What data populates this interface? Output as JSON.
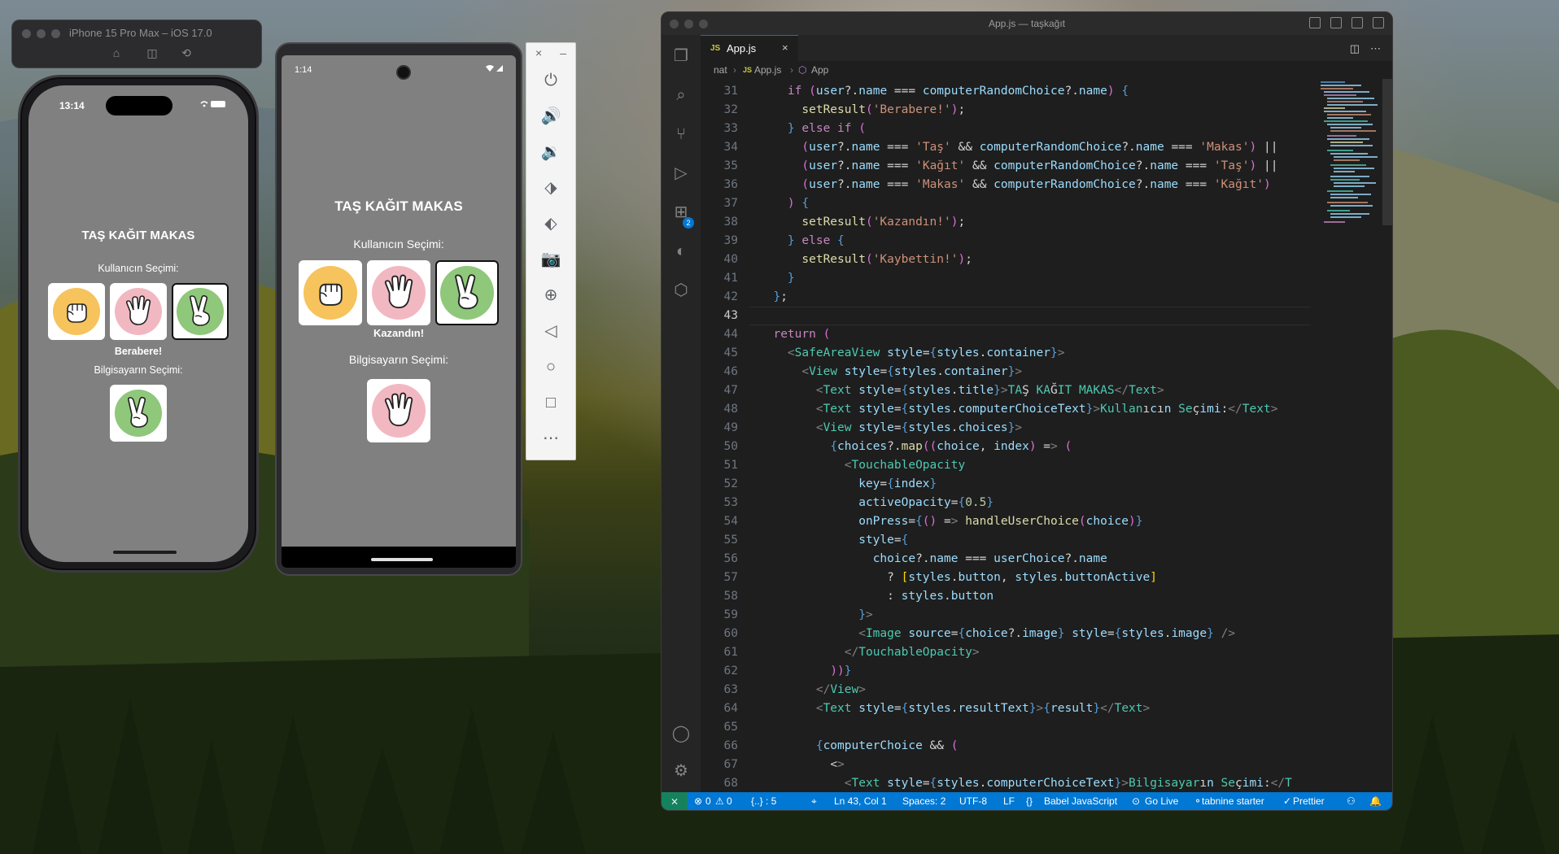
{
  "ios_simulator": {
    "window_title": "iPhone 15 Pro Max – iOS 17.0",
    "time": "13:14",
    "status_icons": "wifi-battery",
    "app": {
      "title": "TAŞ KAĞIT MAKAS",
      "user_label": "Kullanıcın Seçimi:",
      "result": "Berabere!",
      "computer_label": "Bilgisayarın Seçimi:",
      "choices": [
        {
          "name": "Taş",
          "icon": "rock-hand-icon",
          "circle": "#f6c35c"
        },
        {
          "name": "Kağıt",
          "icon": "paper-hand-icon",
          "circle": "#f2b8c2"
        },
        {
          "name": "Makas",
          "icon": "scissors-hand-icon",
          "circle": "#8fc77b",
          "active": true
        }
      ],
      "computer_choice": {
        "name": "Makas",
        "icon": "scissors-hand-icon",
        "circle": "#8fc77b"
      }
    }
  },
  "android_emulator": {
    "time": "1:14",
    "app": {
      "title": "TAŞ KAĞIT MAKAS",
      "user_label": "Kullanıcın Seçimi:",
      "result": "Kazandın!",
      "computer_label": "Bilgisayarın Seçimi:",
      "choices": [
        {
          "name": "Taş",
          "icon": "rock-hand-icon",
          "circle": "#f6c35c"
        },
        {
          "name": "Kağıt",
          "icon": "paper-hand-icon",
          "circle": "#f2b8c2"
        },
        {
          "name": "Makas",
          "icon": "scissors-hand-icon",
          "circle": "#8fc77b",
          "active": true
        }
      ],
      "computer_choice": {
        "name": "Kağıt",
        "icon": "paper-hand-icon",
        "circle": "#f2b8c2"
      }
    },
    "side_panel": [
      "power-icon",
      "volume-up-icon",
      "volume-down-icon",
      "rotate-left-icon",
      "rotate-right-icon",
      "camera-icon",
      "zoom-icon",
      "back-icon",
      "home-icon",
      "overview-icon",
      "more-icon"
    ]
  },
  "vscode": {
    "window_title": "App.js — taşkağıt",
    "tab": {
      "badge": "JS",
      "label": "App.js"
    },
    "breadcrumb": [
      "nat",
      "App.js",
      "App"
    ],
    "activity_badge": "2",
    "first_line_number": 31,
    "current_line": 43,
    "code_lines": [
      "    if (user?.name === computerRandomChoice?.name) {",
      "      setResult('Berabere!');",
      "    } else if (",
      "      (user?.name === 'Taş' && computerRandomChoice?.name === 'Makas') ||",
      "      (user?.name === 'Kağıt' && computerRandomChoice?.name === 'Taş') ||",
      "      (user?.name === 'Makas' && computerRandomChoice?.name === 'Kağıt')",
      "    ) {",
      "      setResult('Kazandın!');",
      "    } else {",
      "      setResult('Kaybettin!');",
      "    }",
      "  };",
      "",
      "  return (",
      "    <SafeAreaView style={styles.container}>",
      "      <View style={styles.container}>",
      "        <Text style={styles.title}>TAŞ KAĞIT MAKAS</Text>",
      "        <Text style={styles.computerChoiceText}>Kullanıcın Seçimi:</Text>",
      "        <View style={styles.choices}>",
      "          {choices?.map((choice, index) => (",
      "            <TouchableOpacity",
      "              key={index}",
      "              activeOpacity={0.5}",
      "              onPress={() => handleUserChoice(choice)}",
      "              style={",
      "                choice?.name === userChoice?.name",
      "                  ? [styles.button, styles.buttonActive]",
      "                  : styles.button",
      "              }>",
      "              <Image source={choice?.image} style={styles.image} />",
      "            </TouchableOpacity>",
      "          ))}",
      "        </View>",
      "        <Text style={styles.resultText}>{result}</Text>",
      "",
      "        {computerChoice && (",
      "          <>",
      "            <Text style={styles.computerChoiceText}>Bilgisayarın Seçimi:</T"
    ],
    "status": {
      "errors": "0",
      "warnings": "0",
      "braces": "{..} : 5",
      "position": "Ln 43, Col 1",
      "spaces": "Spaces: 2",
      "encoding": "UTF-8",
      "eol": "LF",
      "language": "Babel JavaScript",
      "golive": "Go Live",
      "tabnine": "tabnine starter",
      "prettier": "Prettier"
    }
  }
}
